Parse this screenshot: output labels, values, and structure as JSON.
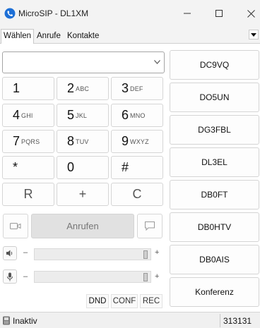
{
  "window": {
    "title": "MicroSIP - DL1XM"
  },
  "tabs": [
    "Wählen",
    "Anrufe",
    "Kontakte"
  ],
  "dial": {
    "number_value": ""
  },
  "keypad": [
    {
      "digit": "1",
      "letters": ""
    },
    {
      "digit": "2",
      "letters": "ABC"
    },
    {
      "digit": "3",
      "letters": "DEF"
    },
    {
      "digit": "4",
      "letters": "GHI"
    },
    {
      "digit": "5",
      "letters": "JKL"
    },
    {
      "digit": "6",
      "letters": "MNO"
    },
    {
      "digit": "7",
      "letters": "PQRS"
    },
    {
      "digit": "8",
      "letters": "TUV"
    },
    {
      "digit": "9",
      "letters": "WXYZ"
    },
    {
      "digit": "*",
      "letters": ""
    },
    {
      "digit": "0",
      "letters": ""
    },
    {
      "digit": "#",
      "letters": ""
    }
  ],
  "func_keys": [
    "R",
    "+",
    "C"
  ],
  "call_button": "Anrufen",
  "volume": {
    "minus": "–",
    "plus": "+",
    "speaker_level": 1.0,
    "mic_level": 1.0
  },
  "toggles": [
    "DND",
    "CONF",
    "REC"
  ],
  "speed_dial": [
    "DC9VQ",
    "DO5UN",
    "DG3FBL",
    "DL3EL",
    "DB0FT",
    "DB0HTV",
    "DB0AIS",
    "Konferenz"
  ],
  "status": {
    "text": "Inaktiv",
    "right": "313131"
  }
}
